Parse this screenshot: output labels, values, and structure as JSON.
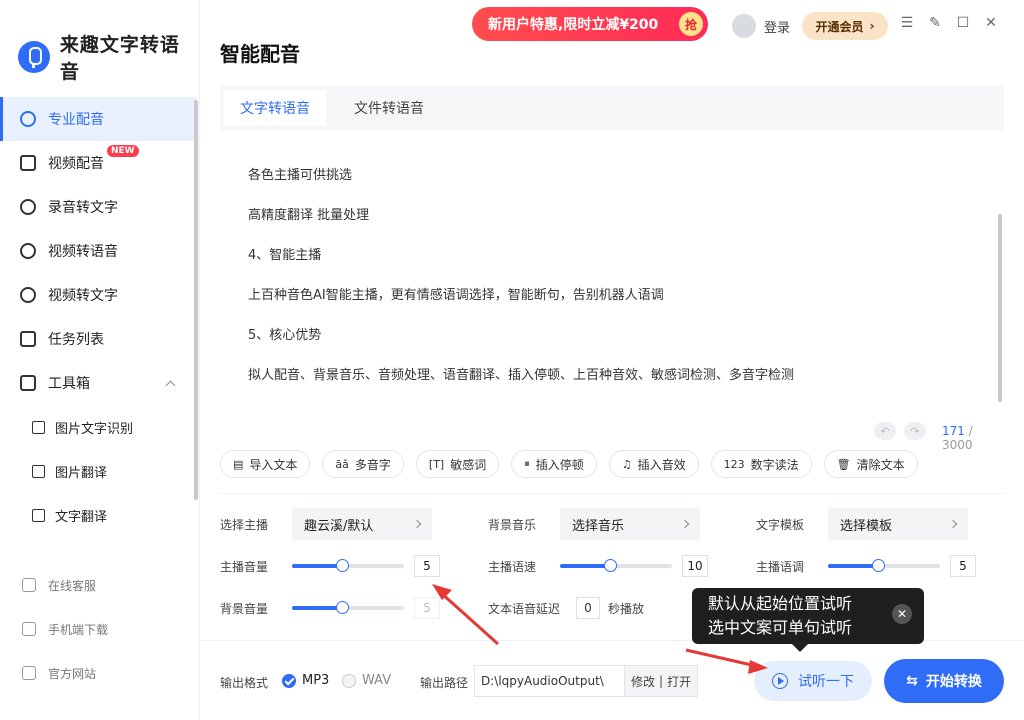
{
  "app": {
    "name": "来趣文字转语音"
  },
  "sidebar": {
    "items": [
      {
        "label": "专业配音",
        "icon": "waveform-icon",
        "active": true
      },
      {
        "label": "视频配音",
        "icon": "video-icon",
        "badge": "NEW"
      },
      {
        "label": "录音转文字",
        "icon": "record-icon"
      },
      {
        "label": "视频转语音",
        "icon": "video-audio-icon"
      },
      {
        "label": "视频转文字",
        "icon": "video-text-icon"
      },
      {
        "label": "任务列表",
        "icon": "task-list-icon"
      },
      {
        "label": "工具箱",
        "icon": "toolbox-icon"
      }
    ],
    "subitems": [
      {
        "label": "图片文字识别",
        "icon": "ocr-icon"
      },
      {
        "label": "图片翻译",
        "icon": "image-icon"
      },
      {
        "label": "文字翻译",
        "icon": "translate-icon"
      }
    ],
    "footer": [
      {
        "label": "在线客服",
        "icon": "headset-icon"
      },
      {
        "label": "手机端下载",
        "icon": "phone-icon"
      },
      {
        "label": "官方网站",
        "icon": "monitor-icon"
      }
    ]
  },
  "header": {
    "page_title": "智能配音",
    "promo": "新用户特惠,限时立减¥200",
    "promo_badge": "抢",
    "login": "登录",
    "vip": "开通会员",
    "vip_arrow": "›"
  },
  "editor": {
    "tabs": [
      {
        "label": "文字转语音",
        "active": true
      },
      {
        "label": "文件转语音"
      }
    ],
    "lines": [
      "各色主播可供挑选",
      "高精度翻译 批量处理",
      "4、智能主播",
      "上百种音色AI智能主播，更有情感语调选择，智能断句，告别机器人语调",
      "5、核心优势",
      "拟人配音、背景音乐、音频处理、语音翻译、插入停顿、上百种音效、敏感词检测、多音字检测"
    ],
    "count": "171",
    "max": " / 3000"
  },
  "toolbar": [
    {
      "label": "导入文本",
      "icon": "import-icon",
      "glyph": "▤"
    },
    {
      "label": "多音字",
      "icon": "polyphone-icon",
      "glyph": "āǎ"
    },
    {
      "label": "敏感词",
      "icon": "sensitive-icon",
      "glyph": "[T]"
    },
    {
      "label": "插入停顿",
      "icon": "pause-icon",
      "glyph": "⏸"
    },
    {
      "label": "插入音效",
      "icon": "music-icon",
      "glyph": "♫"
    },
    {
      "label": "数字读法",
      "icon": "number-icon",
      "glyph": "123"
    },
    {
      "label": "清除文本",
      "icon": "trash-icon",
      "glyph": "🗑"
    }
  ],
  "settings": {
    "anchor_label": "选择主播",
    "anchor_value": "趣云溪/默认",
    "bgm_label": "背景音乐",
    "bgm_value": "选择音乐",
    "template_label": "文字模板",
    "template_value": "选择模板",
    "volume_label": "主播音量",
    "volume_value": "5",
    "volume_level": 0.45,
    "speed_label": "主播语速",
    "speed_value": "10",
    "speed_level": 0.45,
    "pitch_label": "主播语调",
    "pitch_value": "5",
    "pitch_level": 0.45,
    "bg_volume_label": "背景音量",
    "bg_volume_value": "5",
    "bg_volume_level": 0.45,
    "delay_label": "文本语音延迟",
    "delay_value": "0",
    "delay_unit": "秒播放"
  },
  "output": {
    "format_label": "输出格式",
    "formats": [
      {
        "label": "MP3",
        "selected": true
      },
      {
        "label": "WAV",
        "selected": false
      }
    ],
    "path_label": "输出路径",
    "path_value": "D:\\lqpyAudioOutput\\",
    "modify": "修改",
    "sep": "|",
    "open": "打开"
  },
  "actions": {
    "preview": "试听一下",
    "start": "开始转换"
  },
  "tooltip": {
    "line1": "默认从起始位置试听",
    "line2": "选中文案可单句试听"
  },
  "colors": {
    "accent": "#2f6df6",
    "promo": "#ff3b4e",
    "arrow": "#e53935"
  }
}
